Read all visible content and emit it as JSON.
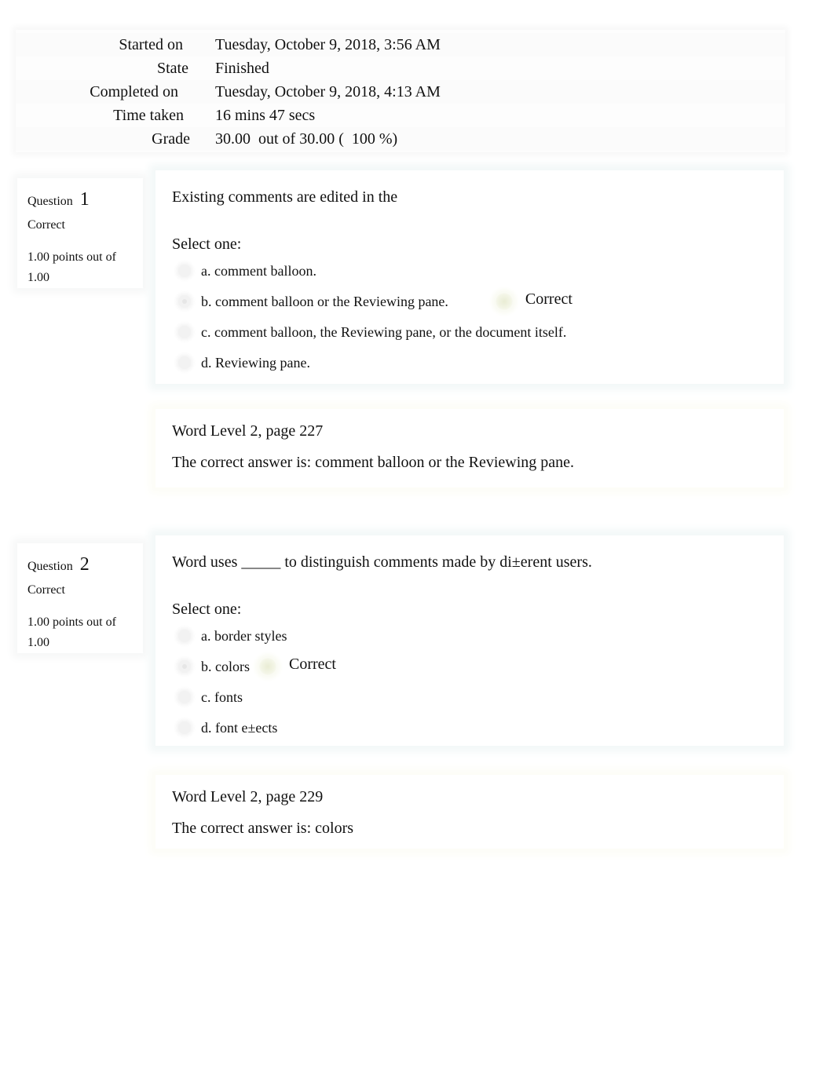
{
  "summary": [
    {
      "label": "Started on",
      "value": "Tuesday, October 9, 2018, 3:56 AM"
    },
    {
      "label": "State",
      "value": "Finished"
    },
    {
      "label": "Completed on",
      "value": "Tuesday, October 9, 2018, 4:13 AM"
    },
    {
      "label": "Time taken",
      "value": "16 mins 47 secs"
    },
    {
      "label": "Grade",
      "value": "30.00  out of 30.00 (  100 %)"
    }
  ],
  "questions": [
    {
      "label": "Question",
      "number": "1",
      "state": "Correct",
      "grade": "1.00 points out of 1.00",
      "text": "Existing comments are edited in the",
      "prompt": "Select one:",
      "answers": [
        {
          "label": "a. comment balloon.",
          "selected": false,
          "correct": false
        },
        {
          "label": "b. comment balloon or the Reviewing pane.",
          "selected": true,
          "correct": true
        },
        {
          "label": "c. comment balloon, the Reviewing pane, or the document itself.",
          "selected": false,
          "correct": false
        },
        {
          "label": "d. Reviewing pane.",
          "selected": false,
          "correct": false
        }
      ],
      "result_label": "Correct",
      "general_feedback": "Word Level 2, page 227",
      "right_answer": "The correct answer is: comment balloon or the Reviewing pane."
    },
    {
      "label": "Question",
      "number": "2",
      "state": "Correct",
      "grade": "1.00 points out of 1.00",
      "text": "Word uses _____ to distinguish comments made by di±erent users.",
      "prompt": "Select one:",
      "answers": [
        {
          "label": "a. border styles",
          "selected": false,
          "correct": false
        },
        {
          "label": "b. colors",
          "selected": true,
          "correct": true
        },
        {
          "label": "c. fonts",
          "selected": false,
          "correct": false
        },
        {
          "label": "d. font e±ects",
          "selected": false,
          "correct": false
        }
      ],
      "result_label": "Correct",
      "general_feedback": "Word Level 2, page 229",
      "right_answer": "The correct answer is: colors"
    }
  ],
  "colors": {
    "correct_icon": "#e9ecd4",
    "question_box_glow": "#f3f8f8",
    "feedback_box_glow": "#fdfdf7"
  }
}
